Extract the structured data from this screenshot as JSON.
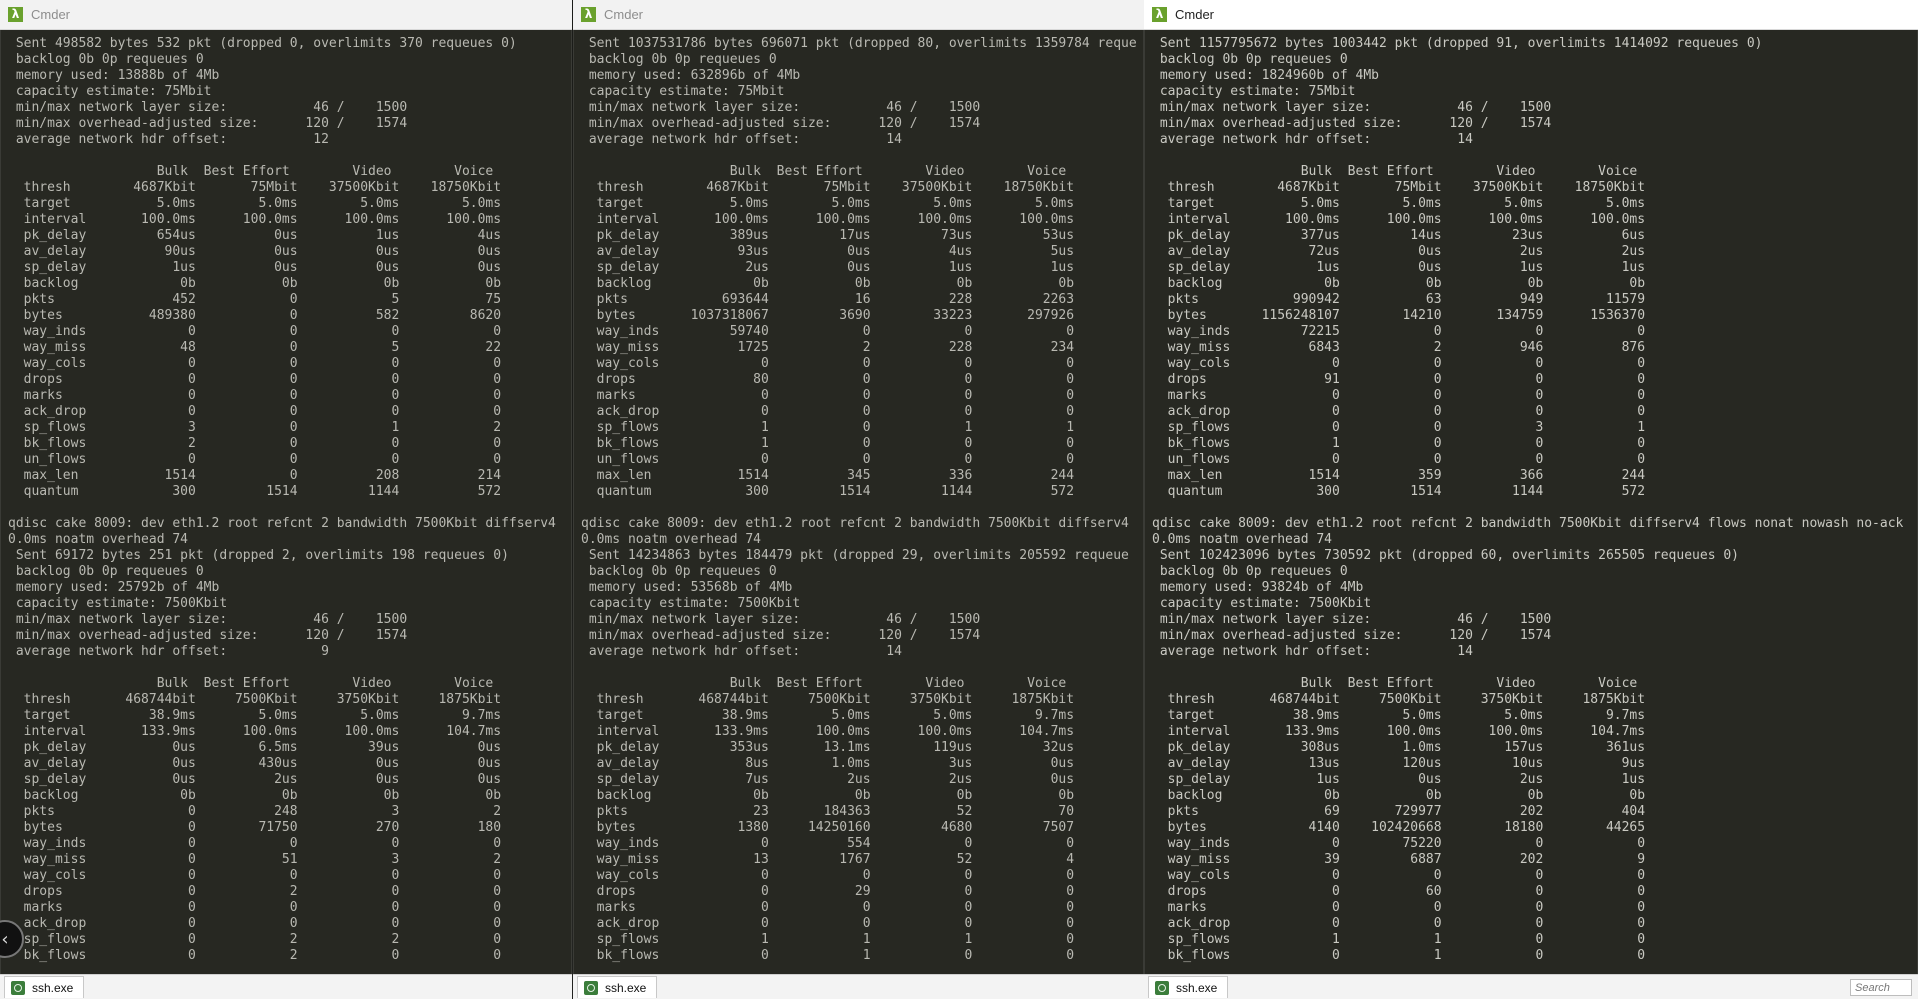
{
  "windows": [
    {
      "title": "Cmder",
      "tab_label": "ssh.exe",
      "search": "",
      "lines": [
        " Sent 498582 bytes 532 pkt (dropped 0, overlimits 370 requeues 0)",
        " backlog 0b 0p requeues 0",
        " memory used: 13888b of 4Mb",
        " capacity estimate: 75Mbit",
        " min/max network layer size:           46 /    1500",
        " min/max overhead-adjusted size:      120 /    1574",
        " average network hdr offset:           12",
        "",
        "                   Bulk  Best Effort        Video        Voice",
        "  thresh        4687Kbit       75Mbit    37500Kbit    18750Kbit",
        "  target           5.0ms        5.0ms        5.0ms        5.0ms",
        "  interval       100.0ms      100.0ms      100.0ms      100.0ms",
        "  pk_delay         654us          0us          1us          4us",
        "  av_delay          90us          0us          0us          0us",
        "  sp_delay           1us          0us          0us          0us",
        "  backlog             0b           0b           0b           0b",
        "  pkts               452            0            5           75",
        "  bytes           489380            0          582         8620",
        "  way_inds             0            0            0            0",
        "  way_miss            48            0            5           22",
        "  way_cols             0            0            0            0",
        "  drops                0            0            0            0",
        "  marks                0            0            0            0",
        "  ack_drop             0            0            0            0",
        "  sp_flows             3            0            1            2",
        "  bk_flows             2            0            0            0",
        "  un_flows             0            0            0            0",
        "  max_len           1514            0          208          214",
        "  quantum            300         1514         1144          572",
        "",
        "qdisc cake 8009: dev eth1.2 root refcnt 2 bandwidth 7500Kbit diffserv4",
        "0.0ms noatm overhead 74",
        " Sent 69172 bytes 251 pkt (dropped 2, overlimits 198 requeues 0)",
        " backlog 0b 0p requeues 0",
        " memory used: 25792b of 4Mb",
        " capacity estimate: 7500Kbit",
        " min/max network layer size:           46 /    1500",
        " min/max overhead-adjusted size:      120 /    1574",
        " average network hdr offset:            9",
        "",
        "                   Bulk  Best Effort        Video        Voice",
        "  thresh       468744bit     7500Kbit     3750Kbit     1875Kbit",
        "  target          38.9ms        5.0ms        5.0ms        9.7ms",
        "  interval       133.9ms      100.0ms      100.0ms      104.7ms",
        "  pk_delay           0us        6.5ms         39us          0us",
        "  av_delay           0us        430us          0us          0us",
        "  sp_delay           0us          2us          0us          0us",
        "  backlog             0b           0b           0b           0b",
        "  pkts                 0          248            3            2",
        "  bytes                0        71750          270          180",
        "  way_inds             0            0            0            0",
        "  way_miss             0           51            3            2",
        "  way_cols             0            0            0            0",
        "  drops                0            2            0            0",
        "  marks                0            0            0            0",
        "  ack_drop             0            0            0            0",
        "  sp_flows             0            2            2            0",
        "  bk_flows             0            2            0            0"
      ]
    },
    {
      "title": "Cmder",
      "tab_label": "ssh.exe",
      "search": "",
      "lines": [
        " Sent 1037531786 bytes 696071 pkt (dropped 80, overlimits 1359784 reque",
        " backlog 0b 0p requeues 0",
        " memory used: 632896b of 4Mb",
        " capacity estimate: 75Mbit",
        " min/max network layer size:           46 /    1500",
        " min/max overhead-adjusted size:      120 /    1574",
        " average network hdr offset:           14",
        "",
        "                   Bulk  Best Effort        Video        Voice",
        "  thresh        4687Kbit       75Mbit    37500Kbit    18750Kbit",
        "  target           5.0ms        5.0ms        5.0ms        5.0ms",
        "  interval       100.0ms      100.0ms      100.0ms      100.0ms",
        "  pk_delay         389us         17us         73us         53us",
        "  av_delay          93us          0us          4us          5us",
        "  sp_delay           2us          0us          1us          1us",
        "  backlog             0b           0b           0b           0b",
        "  pkts            693644           16          228         2263",
        "  bytes       1037318067         3690        33223       297926",
        "  way_inds         59740            0            0            0",
        "  way_miss          1725            2          228          234",
        "  way_cols             0            0            0            0",
        "  drops               80            0            0            0",
        "  marks                0            0            0            0",
        "  ack_drop             0            0            0            0",
        "  sp_flows             1            0            1            1",
        "  bk_flows             1            0            0            0",
        "  un_flows             0            0            0            0",
        "  max_len           1514          345          336          244",
        "  quantum            300         1514         1144          572",
        "",
        "qdisc cake 8009: dev eth1.2 root refcnt 2 bandwidth 7500Kbit diffserv4",
        "0.0ms noatm overhead 74",
        " Sent 14234863 bytes 184479 pkt (dropped 29, overlimits 205592 requeue",
        " backlog 0b 0p requeues 0",
        " memory used: 53568b of 4Mb",
        " capacity estimate: 7500Kbit",
        " min/max network layer size:           46 /    1500",
        " min/max overhead-adjusted size:      120 /    1574",
        " average network hdr offset:           14",
        "",
        "                   Bulk  Best Effort        Video        Voice",
        "  thresh       468744bit     7500Kbit     3750Kbit     1875Kbit",
        "  target          38.9ms        5.0ms        5.0ms        9.7ms",
        "  interval       133.9ms      100.0ms      100.0ms      104.7ms",
        "  pk_delay         353us       13.1ms        119us         32us",
        "  av_delay           8us        1.0ms          3us          0us",
        "  sp_delay           7us          2us          2us          0us",
        "  backlog             0b           0b           0b           0b",
        "  pkts                23       184363           52           70",
        "  bytes             1380     14250160         4680         7507",
        "  way_inds             0          554            0            0",
        "  way_miss            13         1767           52            4",
        "  way_cols             0            0            0            0",
        "  drops                0           29            0            0",
        "  marks                0            0            0            0",
        "  ack_drop             0            0            0            0",
        "  sp_flows             1            1            1            0",
        "  bk_flows             0            1            0            0"
      ]
    },
    {
      "title": "Cmder",
      "tab_label": "ssh.exe",
      "search": "Search",
      "lines": [
        " Sent 1157795672 bytes 1003442 pkt (dropped 91, overlimits 1414092 requeues 0)",
        " backlog 0b 0p requeues 0",
        " memory used: 1824960b of 4Mb",
        " capacity estimate: 75Mbit",
        " min/max network layer size:           46 /    1500",
        " min/max overhead-adjusted size:      120 /    1574",
        " average network hdr offset:           14",
        "",
        "                   Bulk  Best Effort        Video        Voice",
        "  thresh        4687Kbit       75Mbit    37500Kbit    18750Kbit",
        "  target           5.0ms        5.0ms        5.0ms        5.0ms",
        "  interval       100.0ms      100.0ms      100.0ms      100.0ms",
        "  pk_delay         377us         14us         23us          6us",
        "  av_delay          72us          0us          2us          2us",
        "  sp_delay           1us          0us          1us          1us",
        "  backlog             0b           0b           0b           0b",
        "  pkts            990942           63          949        11579",
        "  bytes       1156248107        14210       134759      1536370",
        "  way_inds         72215            0            0            0",
        "  way_miss          6843            2          946          876",
        "  way_cols             0            0            0            0",
        "  drops               91            0            0            0",
        "  marks                0            0            0            0",
        "  ack_drop             0            0            0            0",
        "  sp_flows             0            0            3            1",
        "  bk_flows             1            0            0            0",
        "  un_flows             0            0            0            0",
        "  max_len           1514          359          366          244",
        "  quantum            300         1514         1144          572",
        "",
        "qdisc cake 8009: dev eth1.2 root refcnt 2 bandwidth 7500Kbit diffserv4 flows nonat nowash no-ack",
        "0.0ms noatm overhead 74",
        " Sent 102423096 bytes 730592 pkt (dropped 60, overlimits 265505 requeues 0)",
        " backlog 0b 0p requeues 0",
        " memory used: 93824b of 4Mb",
        " capacity estimate: 7500Kbit",
        " min/max network layer size:           46 /    1500",
        " min/max overhead-adjusted size:      120 /    1574",
        " average network hdr offset:           14",
        "",
        "                   Bulk  Best Effort        Video        Voice",
        "  thresh       468744bit     7500Kbit     3750Kbit     1875Kbit",
        "  target          38.9ms        5.0ms        5.0ms        9.7ms",
        "  interval       133.9ms      100.0ms      100.0ms      104.7ms",
        "  pk_delay         308us        1.0ms        157us        361us",
        "  av_delay          13us        120us         10us          9us",
        "  sp_delay           1us          0us          2us          1us",
        "  backlog             0b           0b           0b           0b",
        "  pkts                69       729977          202          404",
        "  bytes             4140    102420668        18180        44265",
        "  way_inds             0        75220            0            0",
        "  way_miss            39         6887          202            9",
        "  way_cols             0            0            0            0",
        "  drops                0           60            0            0",
        "  marks                0            0            0            0",
        "  ack_drop             0            0            0            0",
        "  sp_flows             1            1            0            0",
        "  bk_flows             0            1            0            0"
      ]
    }
  ],
  "colors": {
    "terminal_bg": "#272822",
    "terminal_text": "#c9c9c2",
    "app_icon": "#6aa12d",
    "tab_icon": "#3b7d3b"
  },
  "icons": {
    "app": "lambda-icon",
    "tab": "ssh-icon",
    "nav": "back-arrow-icon"
  },
  "symbols": {
    "lambda": "λ",
    "back_arrow": "‹"
  }
}
